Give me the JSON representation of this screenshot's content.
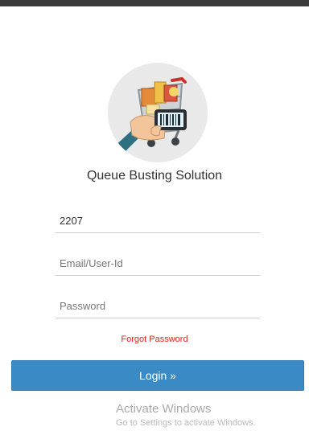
{
  "app": {
    "title": "Queue Busting Solution",
    "logo_icon": "cart-phone-barcode-icon"
  },
  "form": {
    "store_code_value": "2207",
    "email_placeholder": "Email/User-Id",
    "password_placeholder": "Password",
    "forgot_label": "Forgot Password",
    "login_label": "Login »"
  },
  "watermark": {
    "title": "Activate Windows",
    "subtitle": "Go to Settings to activate Windows."
  },
  "colors": {
    "accent": "#3a8ac5",
    "forgot_link": "#e0261b",
    "top_bar": "#3b3b3b"
  }
}
